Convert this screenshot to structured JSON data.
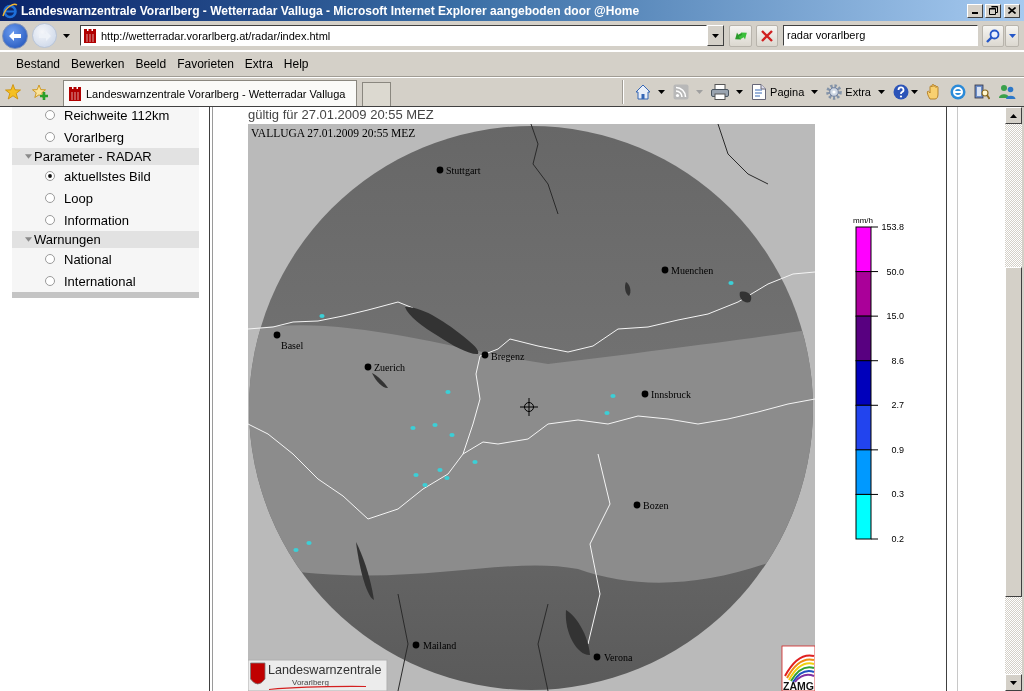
{
  "window": {
    "title": "Landeswarnzentrale Vorarlberg - Wetterradar Valluga - Microsoft Internet Explorer aangeboden door @Home"
  },
  "navigation": {
    "back": {
      "disabled": false
    },
    "forward": {
      "disabled": true
    }
  },
  "address_bar": {
    "url": "http://wetterradar.vorarlberg.at/radar/index.html"
  },
  "search": {
    "value": "radar vorarlberg"
  },
  "menu": [
    "Bestand",
    "Bewerken",
    "Beeld",
    "Favorieten",
    "Extra",
    "Help"
  ],
  "tabs": [
    {
      "label": "Landeswarnzentrale Vorarlberg - Wetterradar Valluga",
      "selected": true
    }
  ],
  "command_bar": {
    "feeds": {
      "disabled": true
    },
    "page_label": "Pagina",
    "tools_label": "Extra"
  },
  "sidebar": {
    "groups": [
      {
        "items": [
          {
            "label": "Reichweite 112km",
            "selected": false
          },
          {
            "label": "Vorarlberg",
            "selected": false
          }
        ]
      },
      {
        "title": "Parameter - RADAR",
        "expanded": true,
        "items": [
          {
            "label": "aktuellstes Bild",
            "selected": true
          },
          {
            "label": "Loop",
            "selected": false
          },
          {
            "label": "Information",
            "selected": false
          }
        ]
      },
      {
        "title": "Warnungen",
        "expanded": true,
        "items": [
          {
            "label": "National",
            "selected": false
          },
          {
            "label": "International",
            "selected": false
          }
        ]
      }
    ]
  },
  "main": {
    "validity": "gültig für 27.01.2009 20:55 MEZ",
    "radar_image": {
      "header": "VALLUGA 27.01.2009 20:55 MEZ",
      "cities": [
        "Stuttgart",
        "Muenchen",
        "Basel",
        "Bregenz",
        "Zuerich",
        "Innsbruck",
        "Bozen",
        "Mailand",
        "Verona"
      ],
      "logos": [
        {
          "kind": "shield",
          "title": "Landeswarnzentrale",
          "subtitle": "Vorarlberg"
        },
        {
          "kind": "rainbow",
          "title": "ZAMG"
        }
      ]
    },
    "legend": {
      "unit": "mm/h",
      "ticks": [
        "153.8",
        "50.0",
        "15.0",
        "8.6",
        "2.7",
        "0.9",
        "0.3",
        "0.2"
      ],
      "bands": [
        {
          "color": "#ff00ff"
        },
        {
          "color": "#aa0099"
        },
        {
          "color": "#580080"
        },
        {
          "color": "#0000bb"
        },
        {
          "color": "#2244ee"
        },
        {
          "color": "#0099ff"
        },
        {
          "color": "#00ffff"
        }
      ]
    }
  }
}
